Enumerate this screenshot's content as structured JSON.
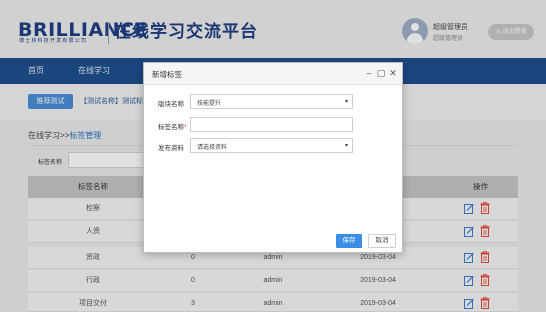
{
  "header": {
    "logo": "BRILLIANCE",
    "logo_sub": "博士林科技开发有限公司",
    "title": "在线学习交流平台",
    "user_name": "超级管理员",
    "user_role": "超级管理员",
    "logout_label": "◎ 退出登录"
  },
  "nav": {
    "items": [
      "首页",
      "在线学习"
    ]
  },
  "subtabs": {
    "active": "推荐测试",
    "other": "【测试名称】测试标"
  },
  "breadcrumb": {
    "prefix": "在线学习>>",
    "current": "标签管理"
  },
  "filter": {
    "label": "标签名称"
  },
  "table": {
    "columns": {
      "name": "标签名称",
      "ops": "操作"
    },
    "rows": [
      {
        "name": "检察",
        "count": "",
        "creator": "",
        "date": ""
      },
      {
        "name": "人资",
        "count": "",
        "creator": "",
        "date": ""
      },
      {
        "name": "资政",
        "count": "0",
        "creator": "admin",
        "date": "2019-03-04"
      },
      {
        "name": "行政",
        "count": "0",
        "creator": "admin",
        "date": "2019-03-04"
      },
      {
        "name": "项目交付",
        "count": "3",
        "creator": "admin",
        "date": "2019-03-04"
      }
    ]
  },
  "modal": {
    "title": "新增标签",
    "fields": {
      "block_label": "版块名称",
      "block_value": "技能提升",
      "tag_label": "标签名称",
      "tag_required": "*",
      "resource_label": "发布资料",
      "resource_placeholder": "请选择资料"
    },
    "save_label": "保存",
    "cancel_label": "取消"
  },
  "colors": {
    "nav": "#1e4f8f",
    "accent": "#3a8ee6",
    "edit_icon": "#3f7fd4",
    "delete_icon": "#e8483a"
  }
}
